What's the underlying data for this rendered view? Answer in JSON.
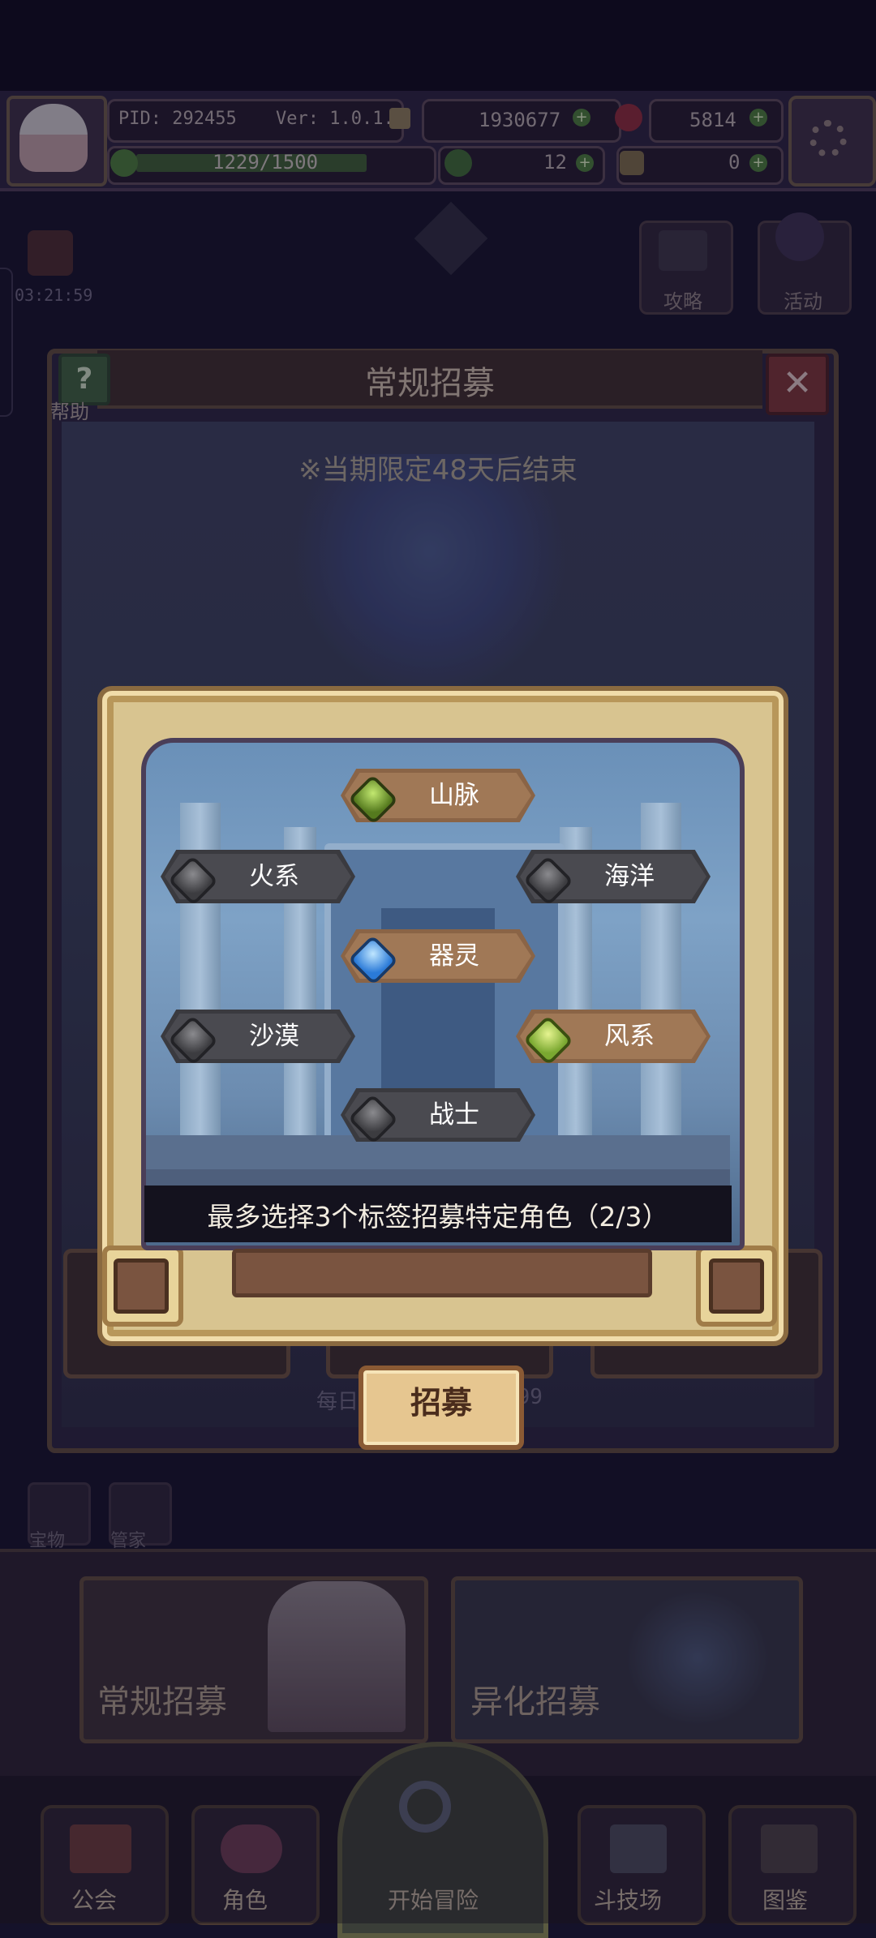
{
  "topbar": {
    "pid": "PID: 292455",
    "version": "Ver: 1.0.1.0",
    "gold": "1930677",
    "gems": "5814",
    "energy": "1229/1500",
    "clover_count": "12",
    "key_count": "0"
  },
  "side": {
    "timer": "03:21:59",
    "guide_label": "攻略",
    "event_label": "活动"
  },
  "panel": {
    "title": "常规招募",
    "help_label": "帮助",
    "help_glyph": "?",
    "close_glyph": "✕",
    "limited_notice": "※当期限定48天后结束",
    "daily_text": "每日",
    "daily_limit": "999"
  },
  "dialog": {
    "tags": [
      {
        "label": "山脉",
        "selected": true,
        "gem": "green-gem-icon"
      },
      {
        "label": "火系",
        "selected": false,
        "gem": "grey-gem-icon"
      },
      {
        "label": "海洋",
        "selected": false,
        "gem": "grey-gem-icon"
      },
      {
        "label": "器灵",
        "selected": true,
        "gem": "blue-gem-icon"
      },
      {
        "label": "沙漠",
        "selected": false,
        "gem": "grey-gem-icon"
      },
      {
        "label": "风系",
        "selected": true,
        "gem": "green-gem-icon"
      },
      {
        "label": "战士",
        "selected": false,
        "gem": "grey-gem-icon"
      }
    ],
    "hint": "最多选择3个标签招募特定角色（2/3）",
    "recruit_button": "招募"
  },
  "small_buttons": {
    "treasure": "宝物",
    "steward": "管家"
  },
  "banners": {
    "normal": "常规招募",
    "special": "异化招募"
  },
  "nav": {
    "guild": "公会",
    "character": "角色",
    "adventure": "开始冒险",
    "arena": "斗技场",
    "codex": "图鉴"
  },
  "colors": {
    "selected_tag": "#a07856",
    "unselected_tag": "#4a4a50",
    "dialog_gold": "#d8c490",
    "recruit_button": "#e6c690"
  }
}
